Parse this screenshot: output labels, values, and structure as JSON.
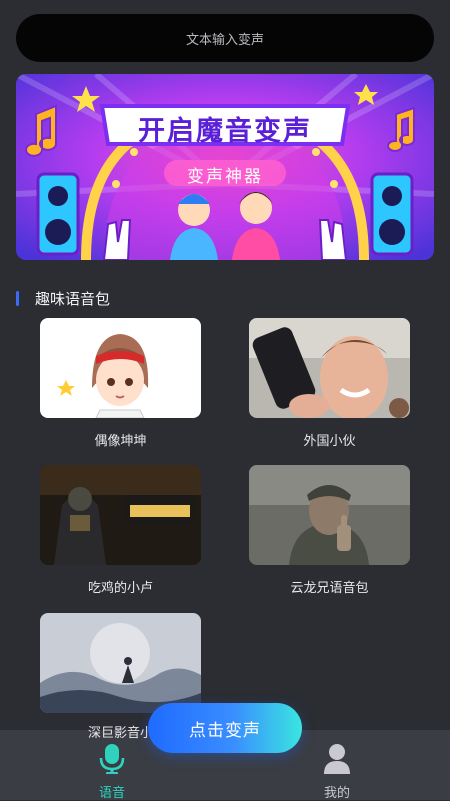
{
  "search": {
    "placeholder": "文本输入变声"
  },
  "banner": {
    "title": "开启魔音变声",
    "subtitle": "变声神器"
  },
  "section": {
    "title": "趣味语音包"
  },
  "packs": [
    {
      "label": "偶像坤坤"
    },
    {
      "label": "外国小伙"
    },
    {
      "label": "吃鸡的小卢"
    },
    {
      "label": "云龙兄语音包"
    },
    {
      "label": "深巨影音小"
    }
  ],
  "cta": {
    "label": "点击变声"
  },
  "tabs": [
    {
      "label": "语音",
      "icon": "microphone-icon",
      "active": true
    },
    {
      "label": "我的",
      "icon": "person-icon",
      "active": false
    }
  ],
  "colors": {
    "accent": "#3b6cf6",
    "active_tab": "#2fd3bd",
    "inactive_tab": "#c9c9cf"
  }
}
